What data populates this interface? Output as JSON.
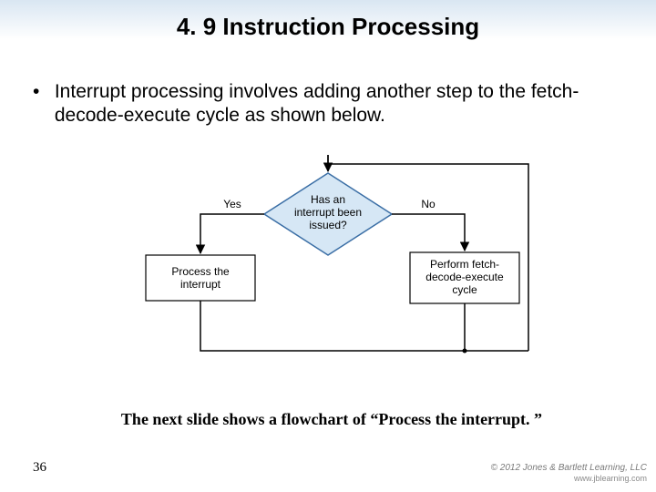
{
  "title": "4. 9 Instruction Processing",
  "bullet": "Interrupt processing involves adding another step to the fetch-decode-execute cycle as shown below.",
  "flow": {
    "decision_l1": "Has an",
    "decision_l2": "interrupt been",
    "decision_l3": "issued?",
    "yes": "Yes",
    "no": "No",
    "left_l1": "Process the",
    "left_l2": "interrupt",
    "right_l1": "Perform fetch-",
    "right_l2": "decode-execute",
    "right_l3": "cycle"
  },
  "note": "The next slide shows a flowchart of “Process the interrupt. ”",
  "page_number": "36",
  "copyright_l1": "© 2012 Jones & Bartlett Learning, LLC",
  "copyright_l2": "www.jblearning.com",
  "chart_data": {
    "type": "flowchart",
    "nodes": [
      {
        "id": "entry",
        "type": "connector",
        "label": ""
      },
      {
        "id": "decision",
        "type": "decision",
        "label": "Has an interrupt been issued?"
      },
      {
        "id": "process_interrupt",
        "type": "process",
        "label": "Process the interrupt"
      },
      {
        "id": "fetch_decode_execute",
        "type": "process",
        "label": "Perform fetch-decode-execute cycle"
      },
      {
        "id": "merge",
        "type": "connector",
        "label": ""
      }
    ],
    "edges": [
      {
        "from": "entry",
        "to": "decision",
        "label": ""
      },
      {
        "from": "decision",
        "to": "process_interrupt",
        "label": "Yes"
      },
      {
        "from": "decision",
        "to": "fetch_decode_execute",
        "label": "No"
      },
      {
        "from": "process_interrupt",
        "to": "merge",
        "label": ""
      },
      {
        "from": "fetch_decode_execute",
        "to": "merge",
        "label": ""
      },
      {
        "from": "merge",
        "to": "entry",
        "label": ""
      }
    ],
    "title": "Interrupt check added to fetch-decode-execute cycle"
  }
}
